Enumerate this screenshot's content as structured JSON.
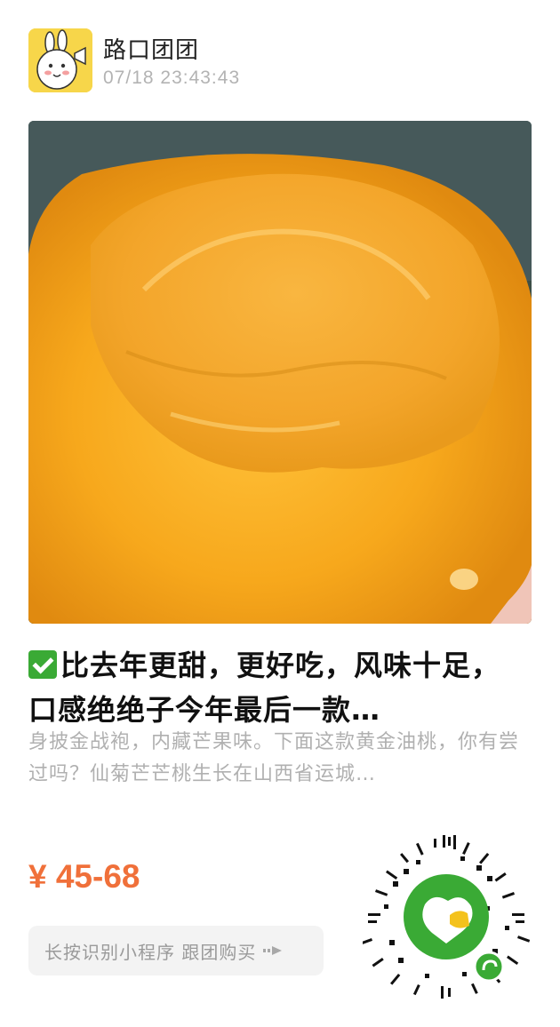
{
  "shop": {
    "name": "路口团团",
    "timestamp": "07/18 23:43:43",
    "avatar_icon": "cartoon-bunny-avatar"
  },
  "product": {
    "image_subject": "golden peach with bite",
    "title_check_icon": "check-mark-icon",
    "title": "比去年更甜，更好吃，风味十足，口感绝绝子今年最后一款…",
    "description": "身披金战袍，内藏芒果味。下面这款黄金油桃，你有尝过吗？仙菊芒芒桃生长在山西省运城…",
    "price": "¥ 45-68"
  },
  "action": {
    "label": "长按识别小程序 跟团购买",
    "icon": "arrow-right-icon"
  },
  "colors": {
    "price": "#f0703a",
    "brand_green": "#3aaa35",
    "avatar_bg": "#f7d64a"
  }
}
